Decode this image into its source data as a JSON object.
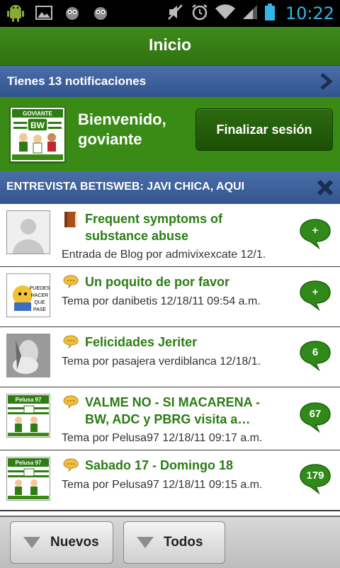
{
  "status_bar": {
    "time": "10:22"
  },
  "title_bar": {
    "title": "Inicio"
  },
  "notifications": {
    "text": "Tienes 13 notificaciones"
  },
  "welcome": {
    "greeting": "Bienvenido, goviante",
    "avatar_caption": "GOVIANTE",
    "avatar_badge": "BW",
    "logout_label": "Finalizar sesión"
  },
  "news": {
    "text": "ENTREVISTA BETISWEB: JAVI CHICA, AQUI"
  },
  "items": [
    {
      "icon": "book-icon",
      "title": "Frequent symptoms of substance abuse",
      "meta": "Entrada de Blog por admivixexcate 12/1.",
      "count": "+"
    },
    {
      "icon": "speech-bubble-icon",
      "title": "Un poquito de por favor",
      "meta": "Tema por danibetis 12/18/11 09:54 a.m.",
      "count": "+",
      "thumb_text": "PUEDES HACER QUE PASE"
    },
    {
      "icon": "speech-bubble-icon",
      "title": "Felicidades Jeriter",
      "meta": "Tema por pasajera verdiblanca 12/18/1.",
      "count": "6"
    },
    {
      "icon": "speech-bubble-icon",
      "title": "VALME NO - SI MACARENA - BW, ADC y PBRG visita a…",
      "meta": "Tema por Pelusa97 12/18/11 09:17 a.m.",
      "count": "67",
      "thumb_text": "Pelusa 97"
    },
    {
      "icon": "speech-bubble-icon",
      "title": "Sabado 17 - Domingo 18",
      "meta": "Tema por Pelusa97 12/18/11 09:15 a.m.",
      "count": "179",
      "thumb_text": "Pelusa 97"
    }
  ],
  "bottom_bar": {
    "new_label": "Nuevos",
    "all_label": "Todos"
  },
  "colors": {
    "green_bar": "#3a8a16",
    "blue_bar": "#3f62a0",
    "title_green": "#2b7d14",
    "clock_blue": "#33b5e5"
  }
}
